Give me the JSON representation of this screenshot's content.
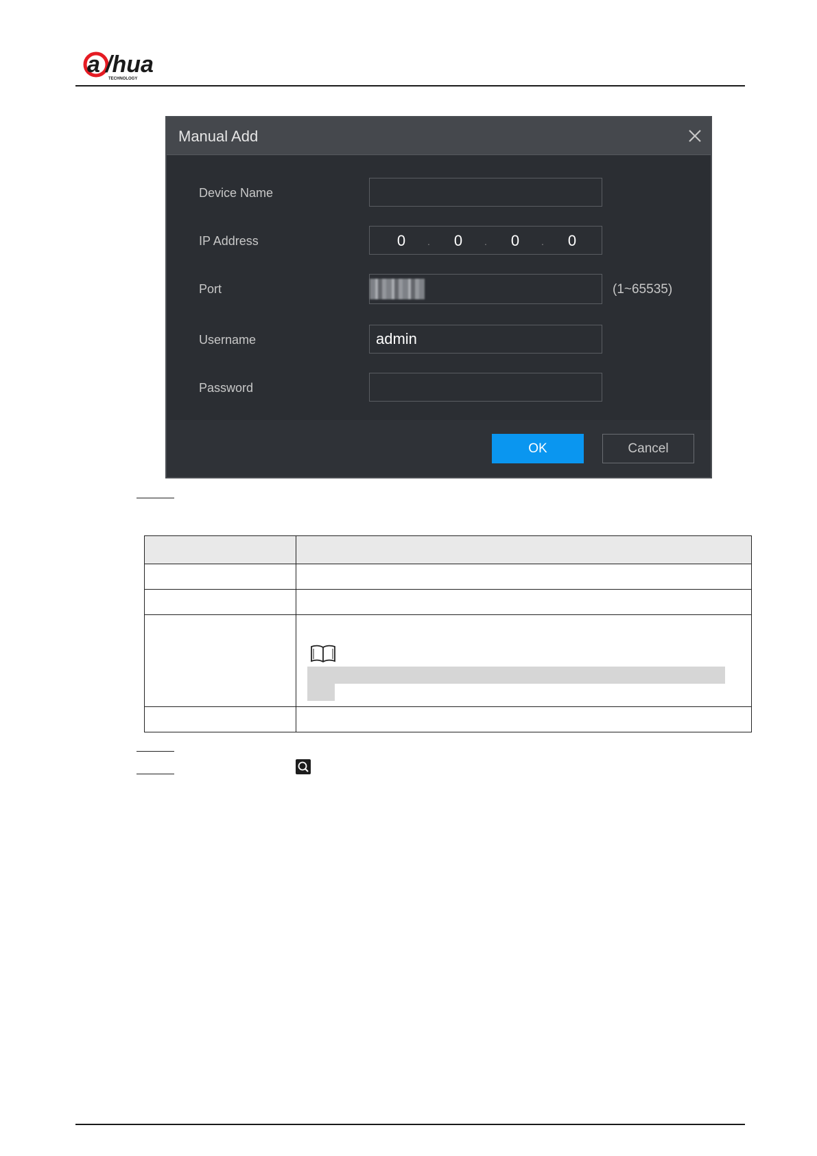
{
  "brand": {
    "logo_text": "alhua",
    "logo_sub": "TECHNOLOGY",
    "accent": "#e51b23"
  },
  "dialog": {
    "title": "Manual Add",
    "close_icon": "close-icon",
    "fields": {
      "device_name": {
        "label": "Device Name",
        "value": ""
      },
      "ip_address": {
        "label": "IP Address",
        "octets": [
          "0",
          "0",
          "0",
          "0"
        ]
      },
      "port": {
        "label": "Port",
        "value": "",
        "hint": "(1~65535)"
      },
      "username": {
        "label": "Username",
        "value": "admin"
      },
      "password": {
        "label": "Password",
        "value": ""
      }
    },
    "ok_label": "OK",
    "cancel_label": "Cancel",
    "ok_color": "#0a96f0"
  },
  "note": {
    "icon": "book-icon"
  },
  "step_icon": "search-icon"
}
